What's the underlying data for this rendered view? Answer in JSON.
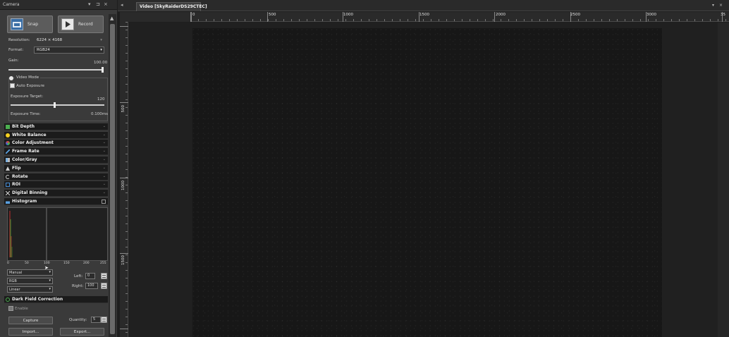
{
  "camera_panel": {
    "title": "Camera",
    "controls": [
      "▾",
      "⊐",
      "×"
    ],
    "snap_label": "Snap",
    "record_label": "Record",
    "resolution_label": "Resolution:",
    "resolution_value": "6224 × 4168",
    "format_label": "Format:",
    "format_value": "RGB24",
    "gain_label": "Gain:",
    "gain_value": "100.00",
    "video_mode_label": "Video Mode",
    "auto_exposure_label": "Auto Exposure",
    "exposure_target_label": "Exposure Target:",
    "exposure_target_value": "120",
    "exposure_time_label": "Exposure Time:",
    "exposure_time_value": "0.100ms",
    "gain_level": 1.0,
    "exposure_target_level": 0.47
  },
  "sections": [
    {
      "label": "Bit Depth",
      "icon": "bit-depth-icon",
      "color": "#4caf50"
    },
    {
      "label": "White Balance",
      "icon": "white-balance-icon",
      "color": "#f5d020"
    },
    {
      "label": "Color Adjustment",
      "icon": "color-adjust-icon",
      "color": "#e04040"
    },
    {
      "label": "Frame Rate",
      "icon": "frame-rate-icon",
      "color": "#5aa0e0"
    },
    {
      "label": "Color/Gray",
      "icon": "color-gray-icon",
      "color": "#7ab0e0"
    },
    {
      "label": "Flip",
      "icon": "flip-icon",
      "color": "#cfcfcf"
    },
    {
      "label": "Rotate",
      "icon": "rotate-icon",
      "color": "#cfcfcf"
    },
    {
      "label": "ROI",
      "icon": "roi-icon",
      "color": "#4a90d9"
    },
    {
      "label": "Digital Binning",
      "icon": "binning-icon",
      "color": "#cfcfcf"
    },
    {
      "label": "Histogram",
      "icon": "histogram-icon",
      "color": "#5aa0e0"
    }
  ],
  "histogram": {
    "ticks": [
      "0",
      "50",
      "100",
      "150",
      "200",
      "255"
    ],
    "mode_value": "Manual",
    "channel_value": "RGB",
    "scale_value": "Linear",
    "left_label": "Left:",
    "left_value": "0",
    "right_label": "Right:",
    "right_value": "100"
  },
  "dark_field": {
    "label": "Dark Field Correction",
    "enable_label": "Enable",
    "capture_label": "Capture",
    "quantity_label": "Quantity:",
    "quantity_value": "5",
    "import_label": "Import...",
    "export_label": "Export..."
  },
  "video": {
    "tab_label": "Video [SkyRaiderDS29CTEC]",
    "ruler_x": [
      "0",
      "500",
      "1000",
      "1500",
      "2000",
      "2500",
      "3000",
      "35"
    ],
    "ruler_y": [
      "500",
      "1000",
      "1500"
    ]
  }
}
